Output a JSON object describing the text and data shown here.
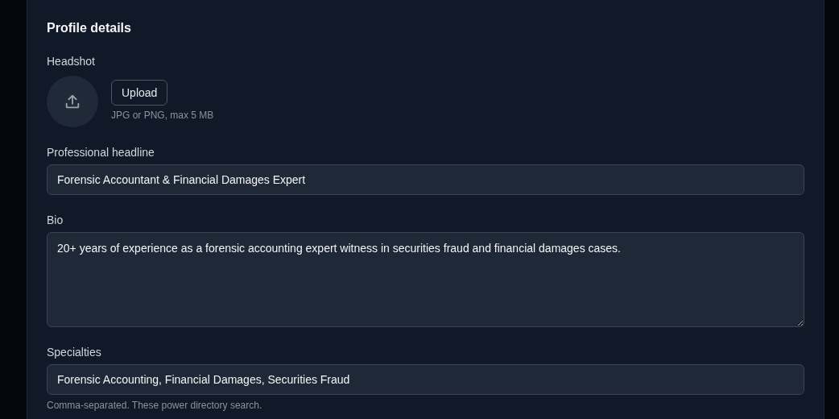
{
  "section": {
    "title": "Profile details"
  },
  "headshot": {
    "label": "Headshot",
    "button": "Upload",
    "hint": "JPG or PNG, max 5 MB"
  },
  "fields": [
    {
      "kind": "input",
      "label": "Professional headline",
      "value": "Forensic Accountant & Financial Damages Expert"
    },
    {
      "kind": "textarea",
      "label": "Bio",
      "value": "20+ years of experience as a forensic accounting expert witness in securities fraud and financial damages cases."
    },
    {
      "kind": "input",
      "label": "Specialties",
      "value": "Forensic Accounting, Financial Damages, Securities Fraud",
      "hint": "Comma-separated. These power directory search."
    }
  ]
}
